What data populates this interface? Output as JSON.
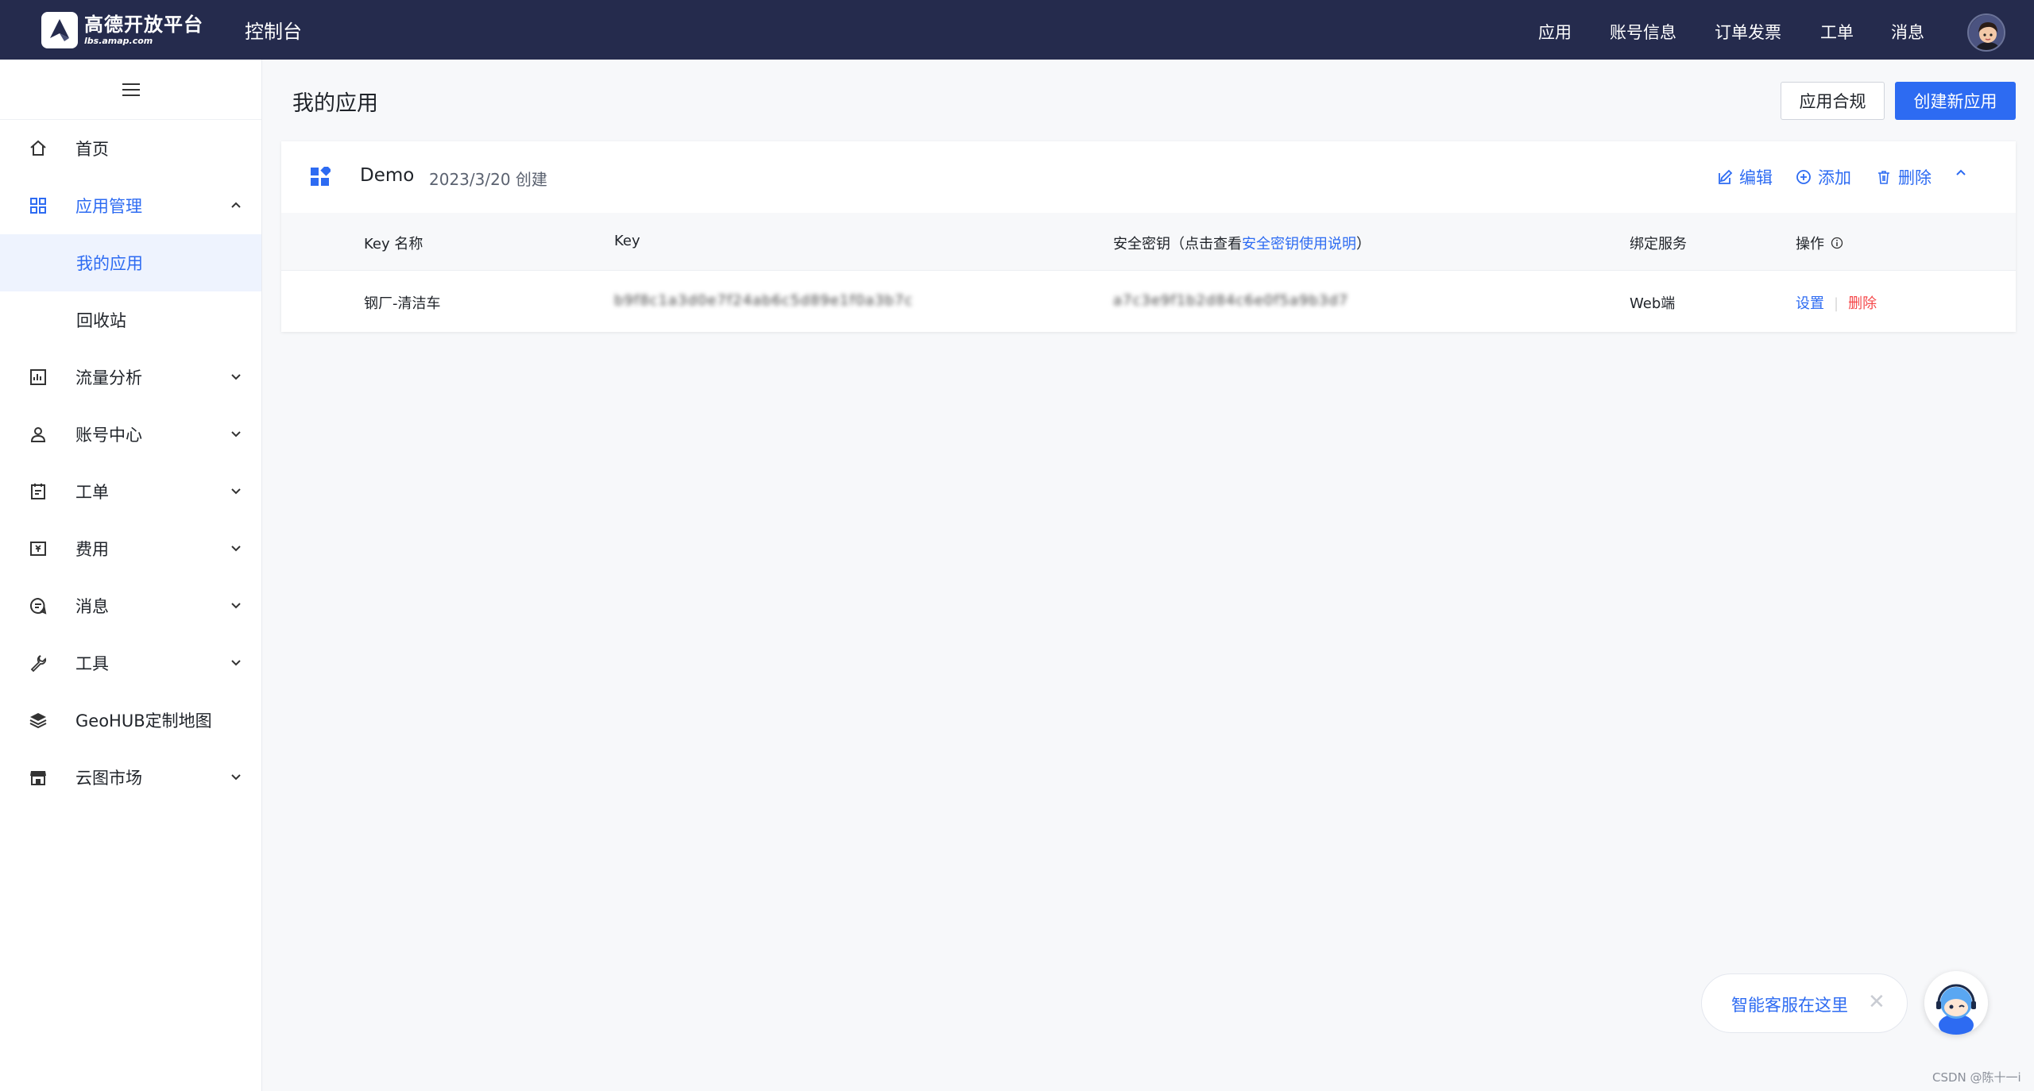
{
  "header": {
    "logo_name": "高德开放平台",
    "logo_url": "lbs.amap.com",
    "console_title": "控制台",
    "nav": [
      "应用",
      "账号信息",
      "订单发票",
      "工单",
      "消息"
    ]
  },
  "sidebar": {
    "items": [
      {
        "label": "首页",
        "icon": "home-icon"
      },
      {
        "label": "应用管理",
        "icon": "grid-icon",
        "expanded": true,
        "children": [
          {
            "label": "我的应用",
            "selected": true
          },
          {
            "label": "回收站"
          }
        ]
      },
      {
        "label": "流量分析",
        "icon": "chart-icon"
      },
      {
        "label": "账号中心",
        "icon": "user-icon"
      },
      {
        "label": "工单",
        "icon": "ticket-icon"
      },
      {
        "label": "费用",
        "icon": "billing-icon"
      },
      {
        "label": "消息",
        "icon": "message-icon"
      },
      {
        "label": "工具",
        "icon": "wrench-icon"
      },
      {
        "label": "GeoHUB定制地图",
        "icon": "layers-icon"
      },
      {
        "label": "云图市场",
        "icon": "store-icon"
      }
    ]
  },
  "main": {
    "page_title": "我的应用",
    "compliance_label": "应用合规",
    "create_label": "创建新应用",
    "app": {
      "name": "Demo",
      "created": "2023/3/20 创建",
      "actions": {
        "edit": "编辑",
        "add": "添加",
        "delete": "删除"
      },
      "table": {
        "headers": {
          "key_name": "Key 名称",
          "key": "Key",
          "secret_prefix": "安全密钥（点击查看",
          "secret_link": "安全密钥使用说明",
          "secret_suffix": "）",
          "service": "绑定服务",
          "operation": "操作"
        },
        "rows": [
          {
            "key_name": "钢厂-清洁车",
            "key": "b9f8c1a3d0e7f24ab6c5d89e1f0a3b7c",
            "secret": "a7c3e9f1b2d84c6e0f5a9b3d7",
            "service": "Web端",
            "op_set": "设置",
            "op_delete": "删除"
          }
        ]
      }
    }
  },
  "chat": {
    "text": "智能客服在这里"
  },
  "watermark": "CSDN @陈十一i",
  "colors": {
    "topbar": "#252b4d",
    "accent": "#2d6bf2",
    "danger": "#f5484a"
  }
}
